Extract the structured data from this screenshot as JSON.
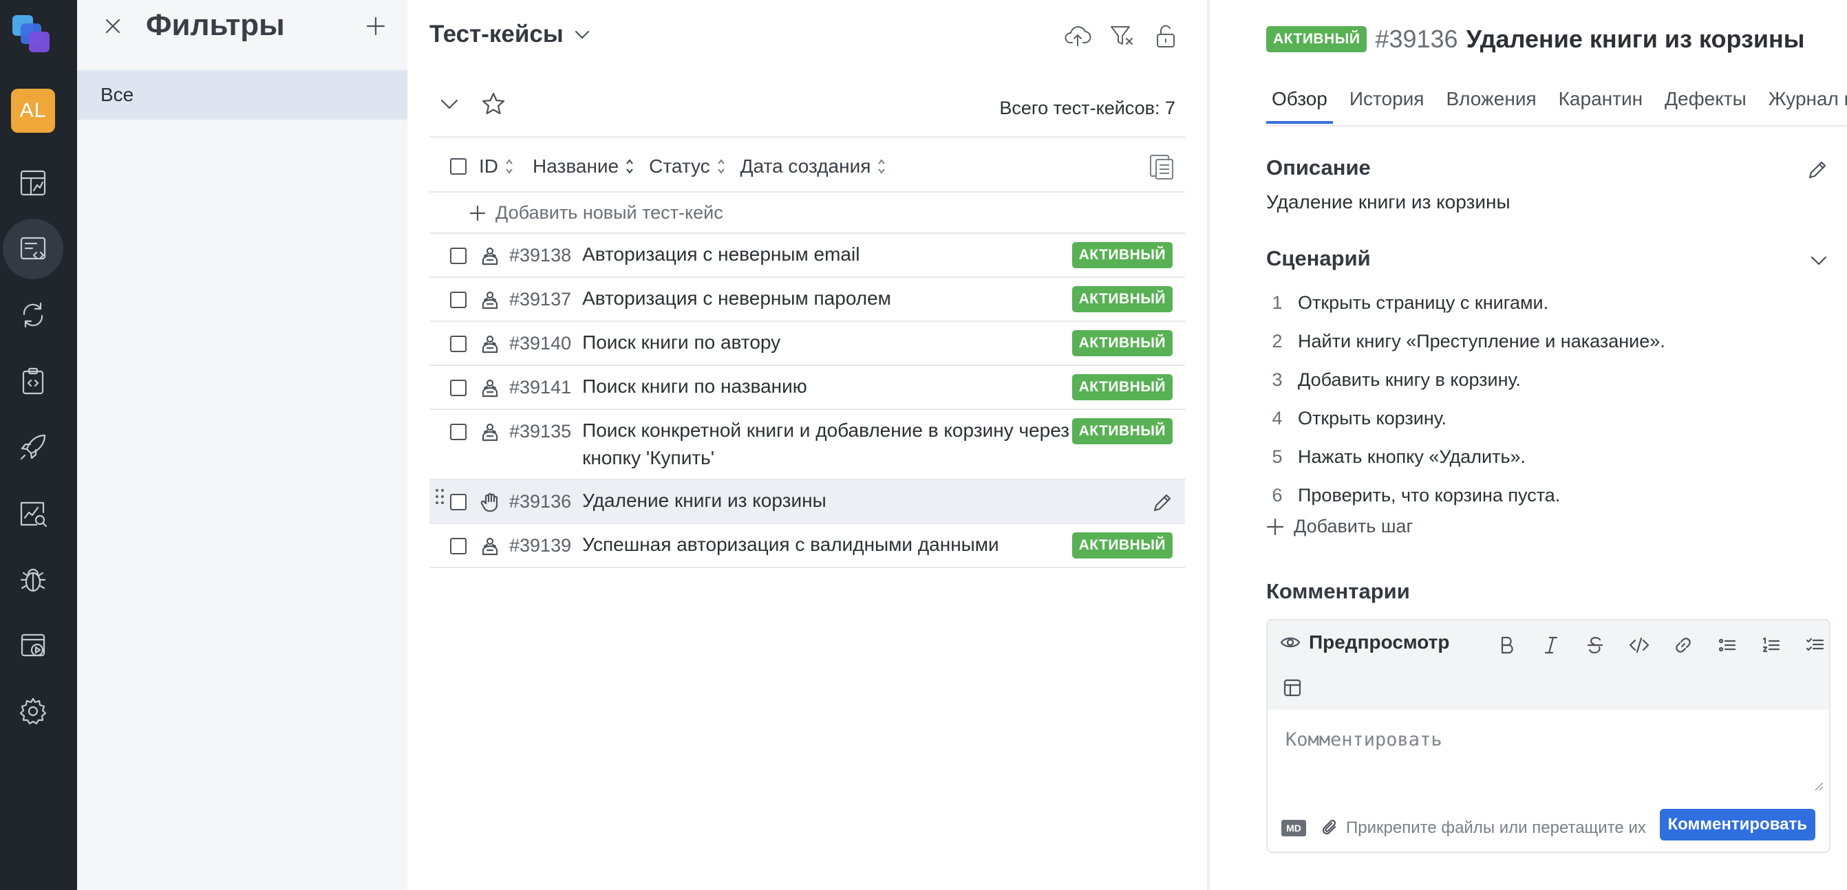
{
  "rail": {
    "avatar": "AL",
    "items": [
      "dashboard-icon",
      "test-cases-icon",
      "sync-icon",
      "clipboard-icon",
      "rocket-icon",
      "analytics-icon",
      "bug-icon",
      "launch-icon",
      "settings-icon"
    ],
    "active_item": "test-cases-icon"
  },
  "filters": {
    "title": "Фильтры",
    "items": [
      "Все"
    ]
  },
  "list": {
    "title": "Тест-кейсы",
    "total_label": "Всего тест-кейсов: 7",
    "columns": [
      "ID",
      "Название",
      "Статус",
      "Дата создания"
    ],
    "add_label": "Добавить новый тест-кейс",
    "rows": [
      {
        "id": "#39138",
        "name": "Авторизация с неверным email",
        "status": "АКТИВНЫЙ",
        "type": "automated"
      },
      {
        "id": "#39137",
        "name": "Авторизация с неверным паролем",
        "status": "АКТИВНЫЙ",
        "type": "automated"
      },
      {
        "id": "#39140",
        "name": "Поиск книги по автору",
        "status": "АКТИВНЫЙ",
        "type": "automated"
      },
      {
        "id": "#39141",
        "name": "Поиск книги по названию",
        "status": "АКТИВНЫЙ",
        "type": "automated"
      },
      {
        "id": "#39135",
        "name": "Поиск конкретной книги и добавление в корзину через кнопку 'Купить'",
        "status": "АКТИВНЫЙ",
        "type": "automated"
      },
      {
        "id": "#39136",
        "name": "Удаление книги из корзины",
        "status": "",
        "type": "manual",
        "selected": true
      },
      {
        "id": "#39139",
        "name": "Успешная авторизация с валидными данными",
        "status": "АКТИВНЫЙ",
        "type": "automated"
      }
    ]
  },
  "details": {
    "status": "АКТИВНЫЙ",
    "id": "#39136",
    "title": "Удаление книги из корзины",
    "tabs": [
      "Обзор",
      "История",
      "Вложения",
      "Карантин",
      "Дефекты",
      "Журнал и"
    ],
    "active_tab": "Обзор",
    "description_title": "Описание",
    "description": "Удаление книги из корзины",
    "scenario_title": "Сценарий",
    "steps": [
      "Открыть страницу с книгами.",
      "Найти книгу «Преступление и наказание».",
      "Добавить книгу в корзину.",
      "Открыть корзину.",
      "Нажать кнопку «Удалить».",
      "Проверить, что корзина пуста."
    ],
    "step_numbers": [
      "1",
      "2",
      "3",
      "4",
      "5",
      "6"
    ],
    "add_step": "Добавить шаг",
    "comments_title": "Комментарии",
    "editor": {
      "preview_label": "Предпросмотр",
      "placeholder": "Комментировать",
      "md_label": "MD",
      "attach_label": "Прикрепите файлы или перетащите их",
      "submit_label": "Комментировать"
    }
  },
  "colors": {
    "rail_bg": "#21252c",
    "badge_green": "#58b154",
    "accent_blue": "#2f6fde",
    "avatar_orange": "#f0a73a"
  }
}
